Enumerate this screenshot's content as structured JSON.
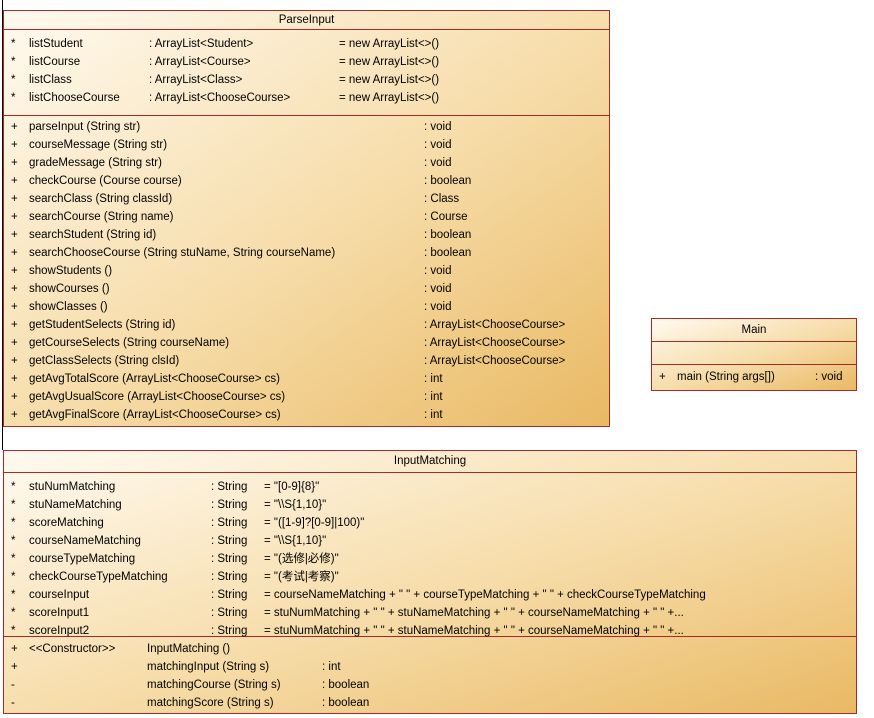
{
  "parse_input": {
    "title": "ParseInput",
    "attributes": [
      {
        "mark": "*",
        "name": "listStudent",
        "type": ": ArrayList<Student>",
        "init": "= new ArrayList<>()"
      },
      {
        "mark": "*",
        "name": "listCourse",
        "type": ": ArrayList<Course>",
        "init": "= new ArrayList<>()"
      },
      {
        "mark": "*",
        "name": "listClass",
        "type": ": ArrayList<Class>",
        "init": "= new ArrayList<>()"
      },
      {
        "mark": "*",
        "name": "listChooseCourse",
        "type": ": ArrayList<ChooseCourse>",
        "init": "= new ArrayList<>()"
      }
    ],
    "methods": [
      {
        "mark": "+",
        "sig": "parseInput (String str)",
        "ret": ": void"
      },
      {
        "mark": "+",
        "sig": "courseMessage (String str)",
        "ret": ": void"
      },
      {
        "mark": "+",
        "sig": "gradeMessage (String str)",
        "ret": ": void"
      },
      {
        "mark": "+",
        "sig": "checkCourse (Course course)",
        "ret": ": boolean"
      },
      {
        "mark": "+",
        "sig": "searchClass (String classId)",
        "ret": ": Class"
      },
      {
        "mark": "+",
        "sig": "searchCourse (String name)",
        "ret": ": Course"
      },
      {
        "mark": "+",
        "sig": "searchStudent (String id)",
        "ret": ": boolean"
      },
      {
        "mark": "+",
        "sig": "searchChooseCourse (String stuName, String courseName)",
        "ret": ": boolean"
      },
      {
        "mark": "+",
        "sig": "showStudents ()",
        "ret": ": void"
      },
      {
        "mark": "+",
        "sig": "showCourses ()",
        "ret": ": void"
      },
      {
        "mark": "+",
        "sig": "showClasses ()",
        "ret": ": void"
      },
      {
        "mark": "+",
        "sig": "getStudentSelects (String id)",
        "ret": ": ArrayList<ChooseCourse>"
      },
      {
        "mark": "+",
        "sig": "getCourseSelects (String courseName)",
        "ret": ": ArrayList<ChooseCourse>"
      },
      {
        "mark": "+",
        "sig": "getClassSelects (String clsId)",
        "ret": ": ArrayList<ChooseCourse>"
      },
      {
        "mark": "+",
        "sig": "getAvgTotalScore (ArrayList<ChooseCourse> cs)",
        "ret": ": int"
      },
      {
        "mark": "+",
        "sig": "getAvgUsualScore (ArrayList<ChooseCourse> cs)",
        "ret": ": int"
      },
      {
        "mark": "+",
        "sig": "getAvgFinalScore (ArrayList<ChooseCourse> cs)",
        "ret": ": int"
      }
    ]
  },
  "main_class": {
    "title": "Main",
    "methods": [
      {
        "mark": "+",
        "sig": "main (String args[])",
        "ret": ": void"
      }
    ]
  },
  "input_matching": {
    "title": "InputMatching",
    "attributes": [
      {
        "mark": "*",
        "name": "stuNumMatching",
        "type": ": String",
        "init": "= \"[0-9]{8}\""
      },
      {
        "mark": "*",
        "name": "stuNameMatching",
        "type": ": String",
        "init": "= \"\\\\S{1,10}\""
      },
      {
        "mark": "*",
        "name": "scoreMatching",
        "type": ": String",
        "init": "= \"([1-9]?[0-9]|100)\""
      },
      {
        "mark": "*",
        "name": "courseNameMatching",
        "type": ": String",
        "init": "= \"\\\\S{1,10}\""
      },
      {
        "mark": "*",
        "name": "courseTypeMatching",
        "type": ": String",
        "init": "= \"(选修|必修)\""
      },
      {
        "mark": "*",
        "name": "checkCourseTypeMatching",
        "type": ": String",
        "init": "= \"(考试|考察)\""
      },
      {
        "mark": "*",
        "name": "courseInput",
        "type": ": String",
        "init": "= courseNameMatching + \" \" + courseTypeMatching + \" \" + checkCourseTypeMatching"
      },
      {
        "mark": "*",
        "name": "scoreInput1",
        "type": ": String",
        "init": "= stuNumMatching + \" \" + stuNameMatching + \" \" + courseNameMatching + \" \" +..."
      },
      {
        "mark": "*",
        "name": "scoreInput2",
        "type": ": String",
        "init": "= stuNumMatching + \" \" + stuNameMatching + \" \" + courseNameMatching + \" \" +..."
      }
    ],
    "methods": [
      {
        "mark": "+",
        "stereo": "<<Constructor>>",
        "sig": "InputMatching ()",
        "ret": ""
      },
      {
        "mark": "+",
        "stereo": "",
        "sig": "matchingInput (String s)",
        "ret": ": int"
      },
      {
        "mark": "-",
        "stereo": "",
        "sig": "matchingCourse (String s)",
        "ret": ": boolean"
      },
      {
        "mark": "-",
        "stereo": "",
        "sig": "matchingScore (String s)",
        "ret": ": boolean"
      }
    ]
  }
}
